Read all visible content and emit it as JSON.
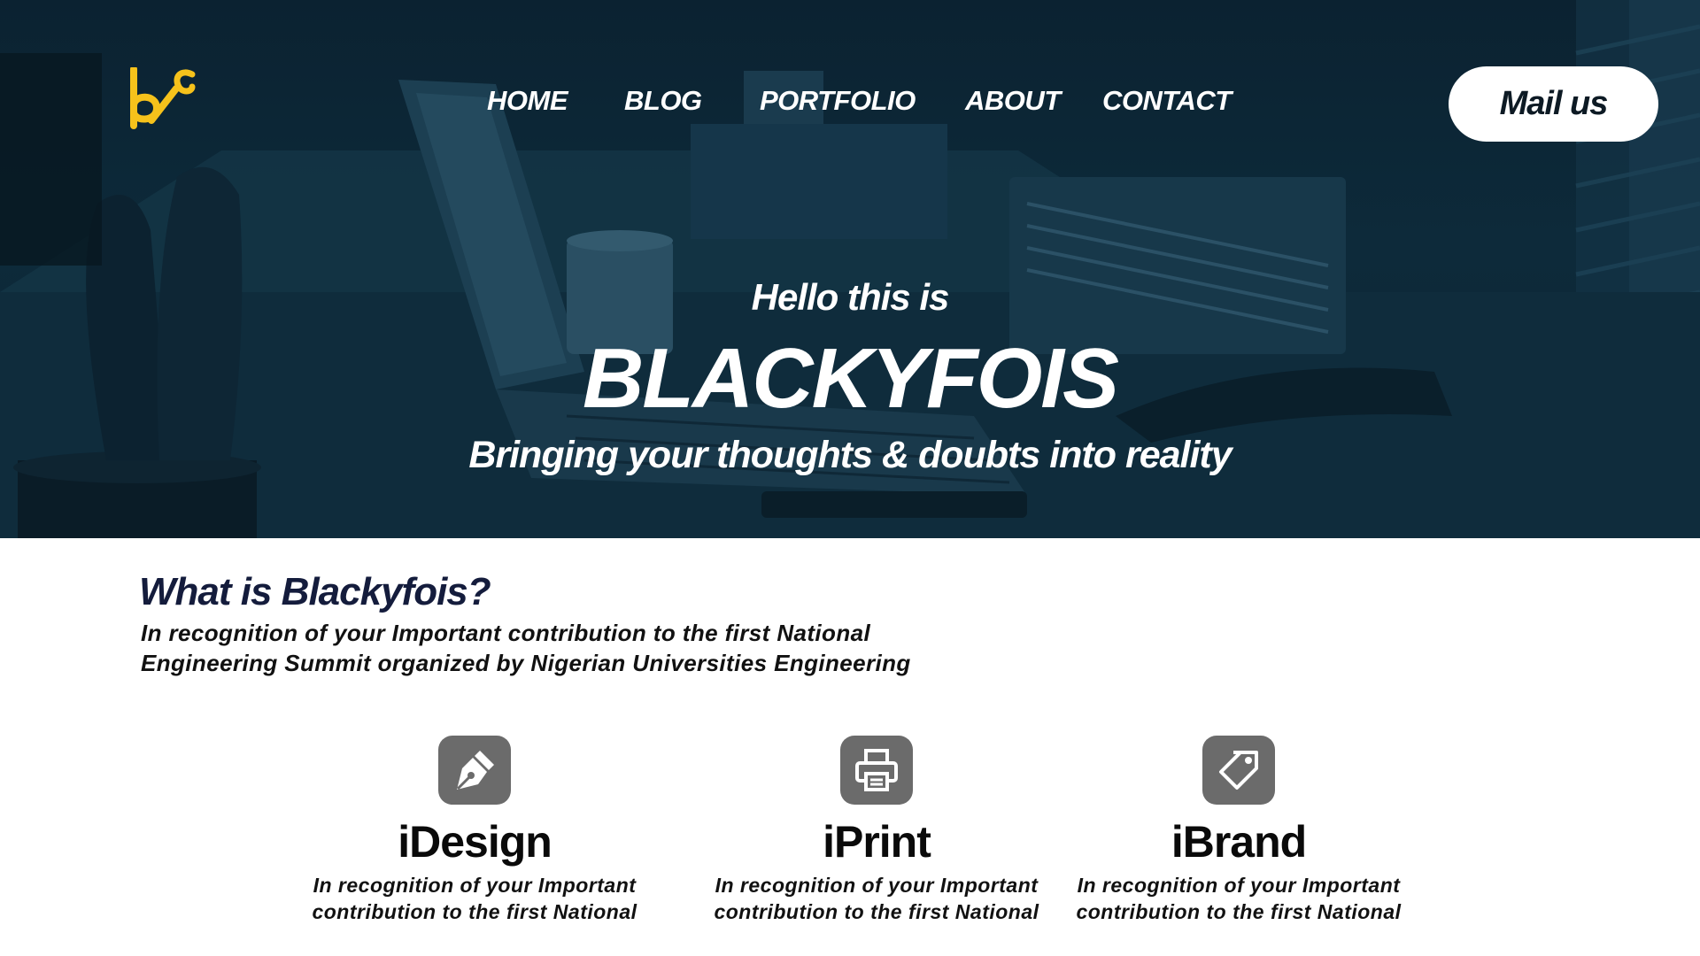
{
  "colors": {
    "hero_overlay": "#0d2a3a",
    "logo_accent": "#f6c21b",
    "heading_navy": "#141c3c",
    "icon_gray": "#6b6b6b"
  },
  "header": {
    "logo_icon": "bf-monogram-logo",
    "nav": [
      "HOME",
      "BLOG",
      "PORTFOLIO",
      "ABOUT",
      "CONTACT"
    ],
    "mail_button": "Mail us"
  },
  "hero": {
    "hello": "Hello this is",
    "name": "BLACKYFOIS",
    "tagline": "Bringing your thoughts & doubts into reality"
  },
  "about": {
    "title": "What is Blackyfois?",
    "lines": [
      "In recognition of your Important contribution to the first National",
      "Engineering Summit organized by Nigerian Universities Engineering"
    ]
  },
  "services": [
    {
      "icon": "pen-nib-icon",
      "title": "iDesign",
      "lines": [
        "In recognition of your Important",
        "contribution to the first National"
      ]
    },
    {
      "icon": "printer-icon",
      "title": "iPrint",
      "lines": [
        "In recognition of your Important",
        "contribution to the first National"
      ]
    },
    {
      "icon": "price-tag-icon",
      "title": "iBrand",
      "lines": [
        "In recognition of your Important",
        "contribution to the first National"
      ]
    }
  ]
}
